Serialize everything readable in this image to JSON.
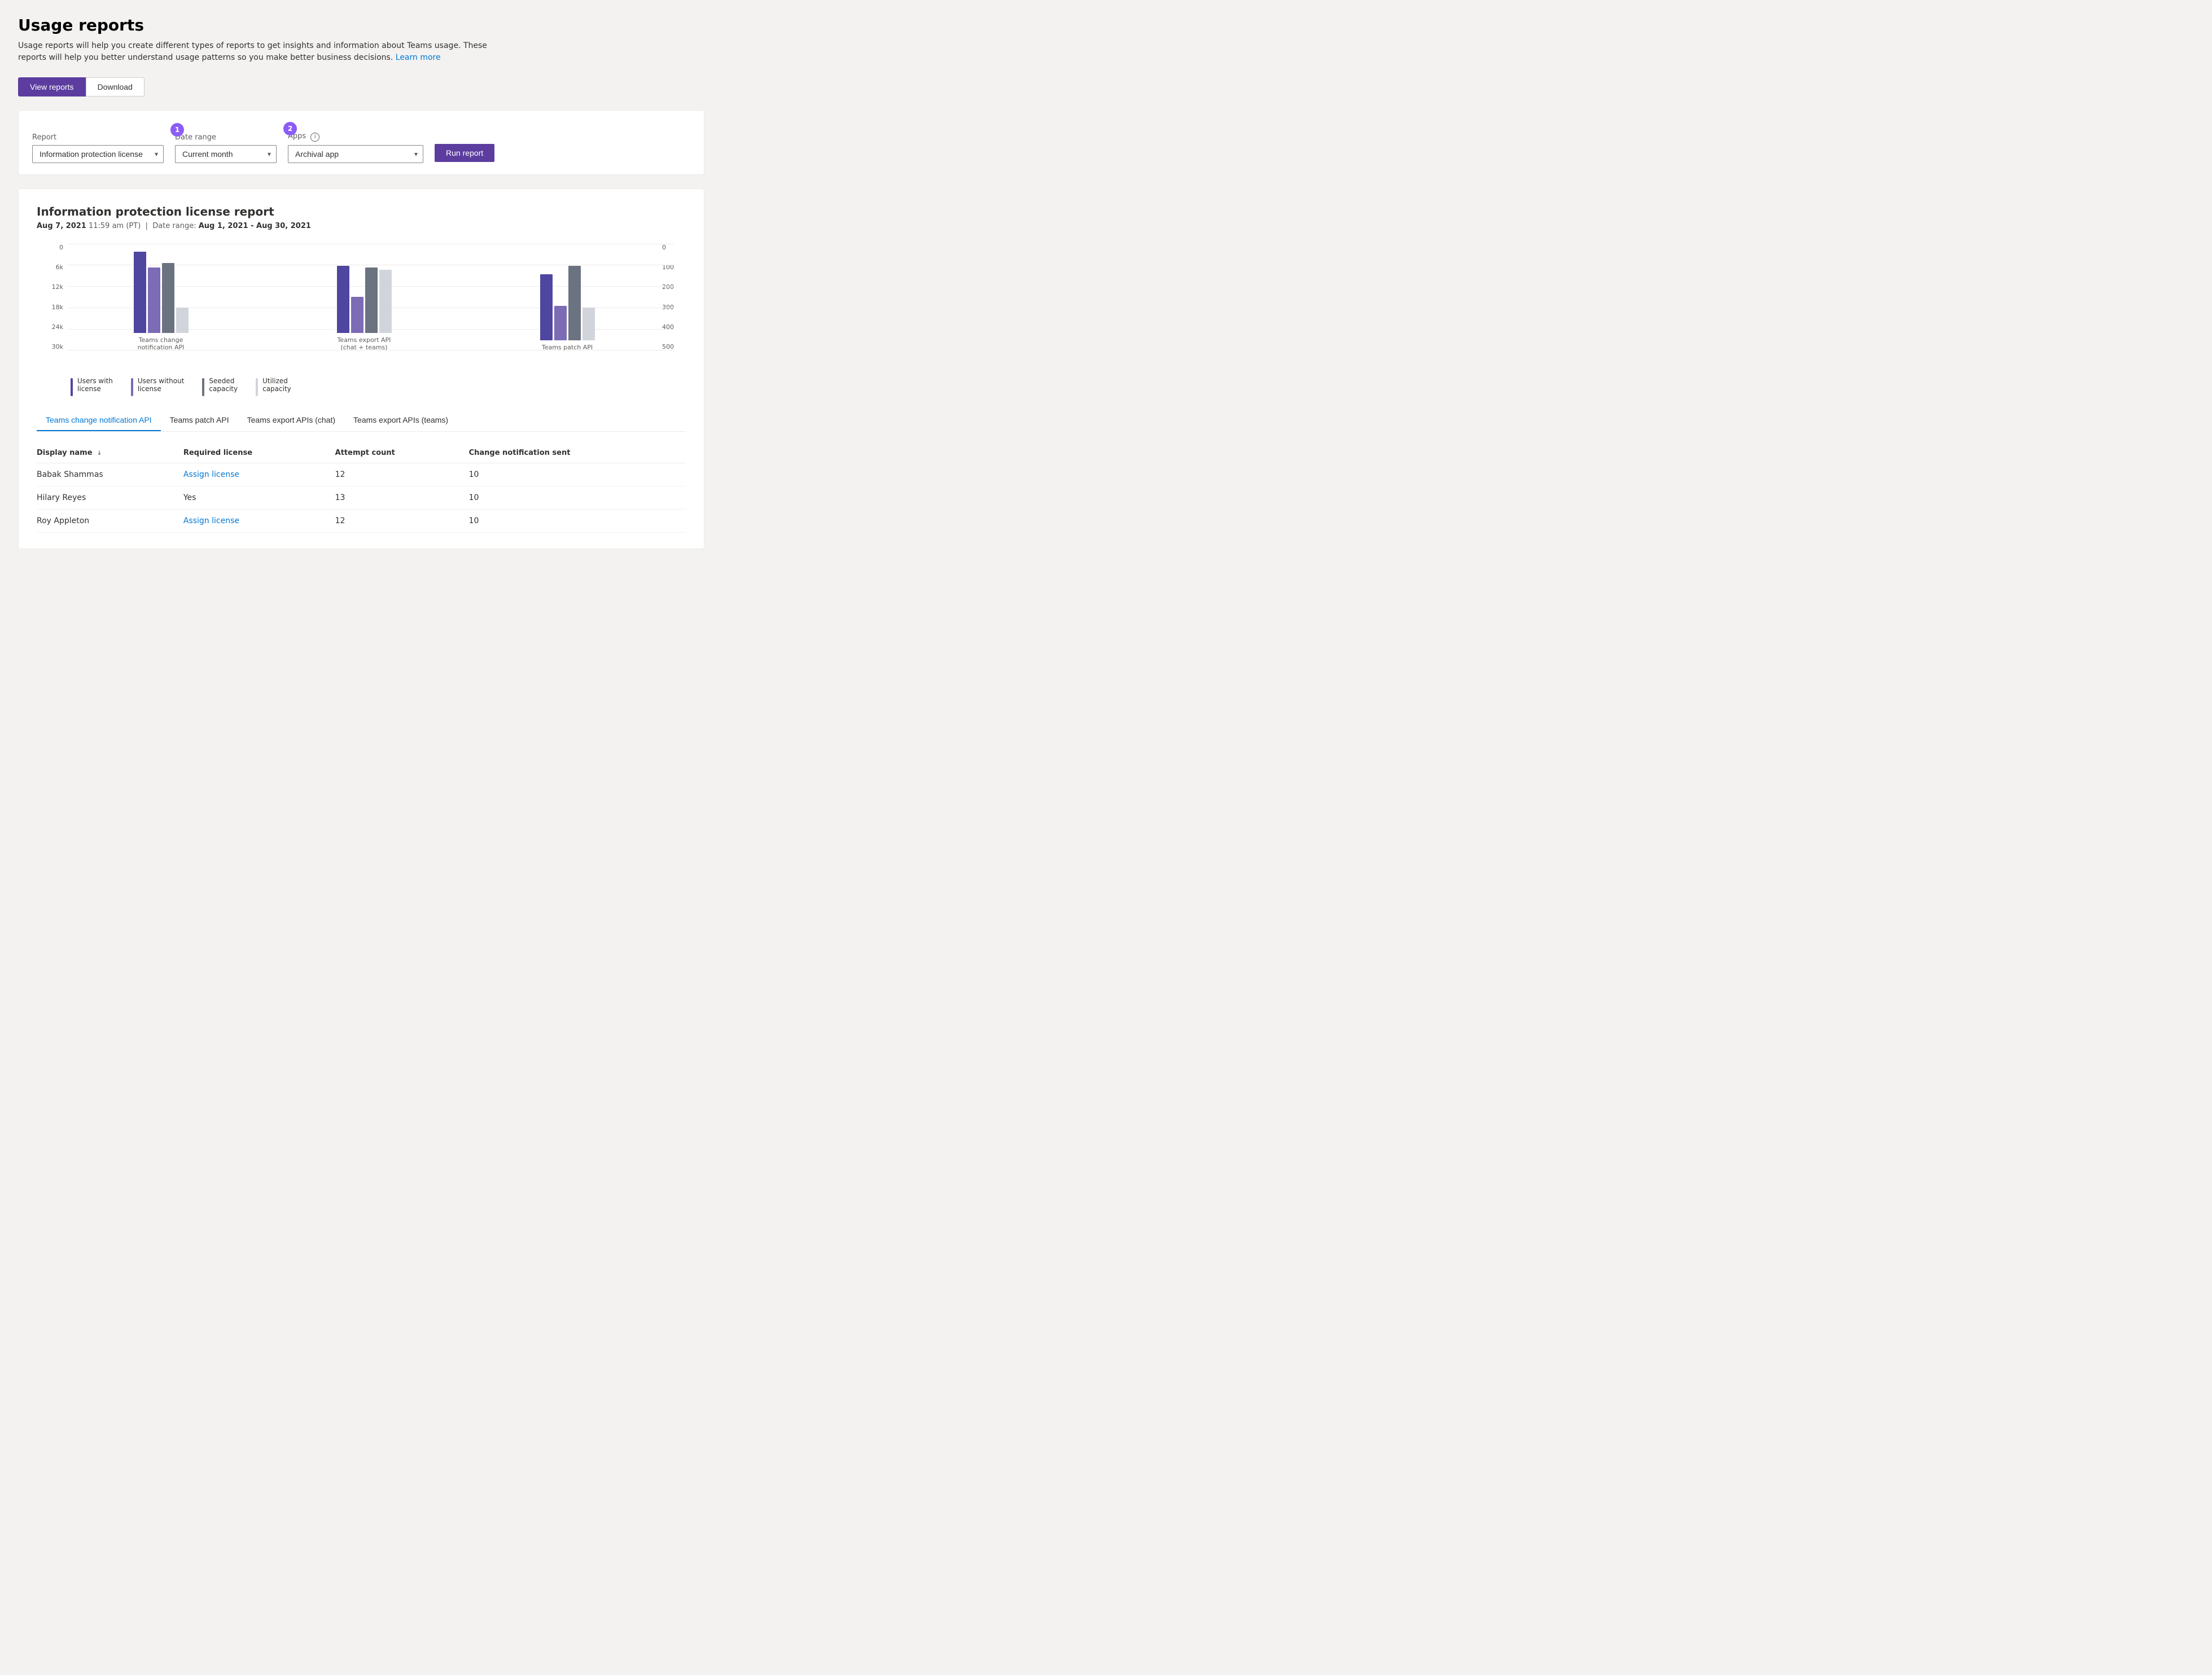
{
  "page": {
    "title": "Usage reports",
    "description": "Usage reports will help you create different types of reports to get insights and information about Teams usage. These reports will help you better understand usage patterns so you make better business decisions.",
    "learn_more": "Learn more"
  },
  "tabs": [
    {
      "id": "view-reports",
      "label": "View reports",
      "active": true
    },
    {
      "id": "download",
      "label": "Download",
      "active": false
    }
  ],
  "filters": {
    "report_label": "Report",
    "report_value": "Information protection license",
    "date_label": "Date range",
    "date_value": "Current month",
    "apps_label": "Apps",
    "apps_info": "i",
    "apps_value": "Archival app",
    "run_button": "Run report"
  },
  "report": {
    "title": "Information protection license report",
    "date": "Aug 7, 2021",
    "time": "11:59 am (PT)",
    "date_range_label": "Date range:",
    "date_range": "Aug 1, 2021 - Aug 30, 2021",
    "chart": {
      "y_axis_left": [
        "0",
        "6k",
        "12k",
        "18k",
        "24k",
        "30k"
      ],
      "y_axis_right": [
        "0",
        "100",
        "200",
        "300",
        "400",
        "500"
      ],
      "groups": [
        {
          "label": "Teams change notification API",
          "bars": [
            {
              "color": "blue",
              "height_pct": 90
            },
            {
              "color": "purple",
              "height_pct": 72
            },
            {
              "color": "gray",
              "height_pct": 77
            },
            {
              "color": "lightgray",
              "height_pct": 28
            }
          ]
        },
        {
          "label": "Teams export API\n(chat + teams)",
          "bars": [
            {
              "color": "blue",
              "height_pct": 74
            },
            {
              "color": "purple",
              "height_pct": 40
            },
            {
              "color": "gray",
              "height_pct": 72
            },
            {
              "color": "lightgray",
              "height_pct": 70
            }
          ]
        },
        {
          "label": "Teams patch API",
          "bars": [
            {
              "color": "blue",
              "height_pct": 73
            },
            {
              "color": "purple",
              "height_pct": 38
            },
            {
              "color": "gray",
              "height_pct": 82
            },
            {
              "color": "lightgray",
              "height_pct": 36
            }
          ]
        }
      ],
      "legend": [
        {
          "color": "#4f46a0",
          "label": "Users with\nlicense"
        },
        {
          "color": "#7c6bb5",
          "label": "Users without\nlicense"
        },
        {
          "color": "#6b7280",
          "label": "Seeded\ncapacity"
        },
        {
          "color": "#d1d5db",
          "label": "Utilized\ncapacity"
        }
      ]
    },
    "data_tabs": [
      {
        "label": "Teams change notification API",
        "active": true
      },
      {
        "label": "Teams patch API",
        "active": false
      },
      {
        "label": "Teams export APIs (chat)",
        "active": false
      },
      {
        "label": "Teams export APIs (teams)",
        "active": false
      }
    ],
    "table": {
      "columns": [
        {
          "label": "Display name",
          "sort": "↓"
        },
        {
          "label": "Required license"
        },
        {
          "label": "Attempt count"
        },
        {
          "label": "Change notification sent"
        }
      ],
      "rows": [
        {
          "display_name": "Babak Shammas",
          "required_license": "Assign license",
          "required_license_link": true,
          "attempt_count": "12",
          "change_notification_sent": "10"
        },
        {
          "display_name": "Hilary Reyes",
          "required_license": "Yes",
          "required_license_link": false,
          "attempt_count": "13",
          "change_notification_sent": "10"
        },
        {
          "display_name": "Roy Appleton",
          "required_license": "Assign license",
          "required_license_link": true,
          "attempt_count": "12",
          "change_notification_sent": "10"
        }
      ]
    }
  }
}
